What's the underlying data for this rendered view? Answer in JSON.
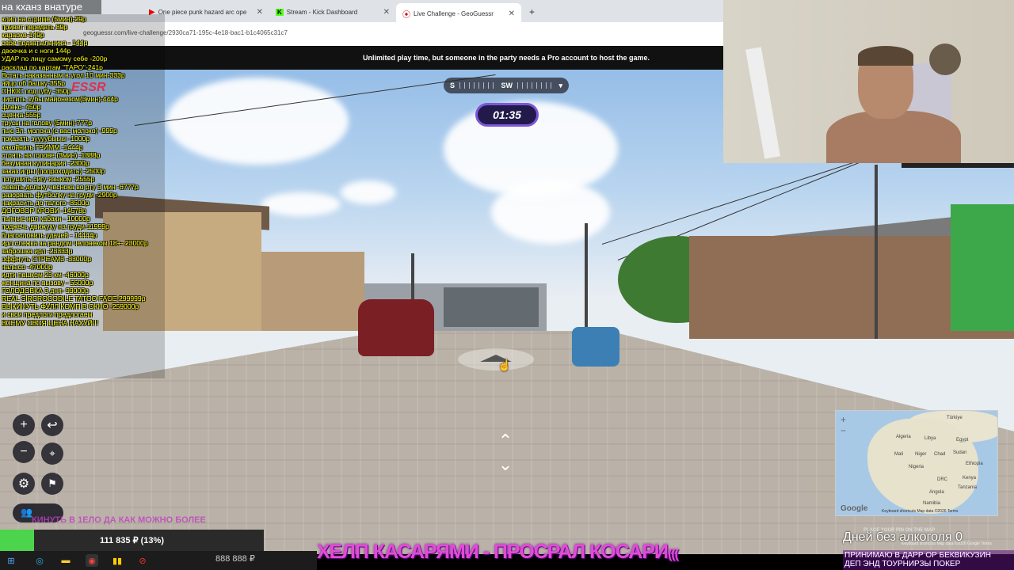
{
  "browser": {
    "tabs": [
      {
        "label": "One piece punk hazard arc ope",
        "icon": "youtube-icon"
      },
      {
        "label": "Stream - Kick Dashboard",
        "icon": "kick-icon"
      },
      {
        "label": "Live Challenge - GeoGuessr",
        "icon": "geoguessr-pin-icon"
      }
    ],
    "new_tab": "+",
    "url": "geoguessr.com/live-challenge/2930ca71-195c-4e18-bac1-b1c4065c31c7"
  },
  "banner": "Unlimited play time, but someone in the party needs a Pro account to host the game.",
  "game": {
    "compass_left": "S",
    "compass_center": "SW",
    "timer": "01:35"
  },
  "overlay": {
    "corner_title": "на кханз внатуре",
    "logo_fragment": "ESSR",
    "price_list": [
      "клип на стриме (5мин)-29р",
      "привет передать 89р",
      "караоке-149р",
      "себе подзатыльника - 144р",
      "двоечка и с ноги 144р",
      "УДАР по лицу самому себе -200р",
      "расклад по картам \"ТАРО\"-241р",
      "Встать наказанным в угол 10 мин-333р",
      "яйцо об башку-355р",
      "СНЮС под губу -350р",
      "чистить зубы майонезом(3мин)-444р",
      "флекс- 450р",
      "сценка-555р",
      "трусы на голову (5мин)-777р",
      "пью 3л. молока (с вас молоко) -999р",
      "показать зуууубыыы -1000р",
      "какойнить ГРИММ -1444р",
      "стоять на голове (3мин) -1888р",
      "безумная кулинария -2300р",
      "заказ игры (попроходить) -2500р",
      "потушить сигу языком -2555р",
      "жевать дольку чеснока во рту 3 мин -6777р",
      "разорвать футболку на груди -2900р",
      "накрасить до талого -8500р",
      "ДОГОВОР КРОВИ -14578р",
      "пьяные ирл кабаки - 10000р",
      "поджечь движуху на груди-11999р",
      "благословить удачей - 14444р",
      "ирл слежка за рандом человеком 18+- 23000р",
      "заброшка ирл -23333р",
      "оффнуть СТРЕАМ3 -33000р",
      "налысо -47000р",
      "идти пешком 23 км -46000р",
      "женщина по вызову - 55000р",
      "ГОЛОДОВКА 3 дня- 99000р",
      "REAL SIRCROCODILE TATOO FACE-299999р",
      "ВЫКИНУТЬ ФУЛЛ КОМП В ОКНО -259000р",
      "и свои предлоги предлогаем",
      "ВСЕМУ СВОЯ ЦЕНА НАХУЙ!!!"
    ],
    "pink_line": "КИНУТЬ В 1ЕЛО ДА КАК МОЖНО БОЛЕЕ",
    "goal_text": "111 835 ₽ (13%)",
    "goal_fraction": 0.13,
    "money_counter": "888 888 ₽",
    "big_title": "ХЕЛП КАСАРЯМИ - ПРОСРАЛ КОСАРИ",
    "big_title_tail": "(((",
    "days_label": "Дней без алкоголя",
    "days_value": "0",
    "donate_lines": [
      "ПРИНИМАЮ В ДАРР ОР БЕКВИКУЗИН",
      "ДЕП ЭНД ТОУРНИРЗЫ ПОКЕР"
    ]
  },
  "minimap": {
    "zoom_in": "+",
    "zoom_out": "−",
    "labels": [
      "Türkiye",
      "Algeria",
      "Libya",
      "Egypt",
      "Mali",
      "Niger",
      "Chad",
      "Sudan",
      "Nigeria",
      "Ethiopia",
      "DRC",
      "Kenya",
      "Tanzania",
      "Angola",
      "Namibia"
    ],
    "google": "Google",
    "keyboard": "Keyboard shortcuts",
    "mapdata": "Map data ©2026",
    "terms": "Terms",
    "place_pin": "PLACE YOUR PIN ON THE MAP",
    "footer": "Keyboard shortcuts   Map data ©2026 Google   Terms"
  },
  "colors": {
    "accent": "#7f56d9",
    "goal": "#4cd44c",
    "title_pink": "#e24bd7",
    "list_yellow": "#ffff00"
  }
}
